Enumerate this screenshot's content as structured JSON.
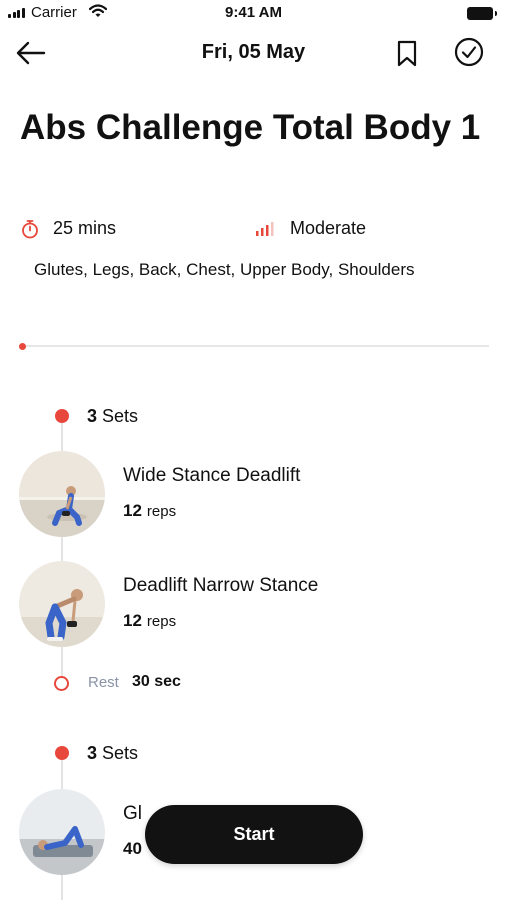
{
  "status_bar": {
    "carrier": "Carrier",
    "time": "9:41 AM",
    "icons": [
      "signal-icon",
      "wifi-icon",
      "battery-icon"
    ]
  },
  "nav": {
    "title": "Fri, 05 May",
    "icons": [
      "back-arrow-icon",
      "bookmark-icon",
      "check-circle-icon"
    ]
  },
  "workout": {
    "title": "Abs Challenge Total Body 1",
    "duration": "25 mins",
    "difficulty": "Moderate",
    "muscles": "Glutes, Legs, Back, Chest, Upper Body, Shoulders",
    "progress": 0
  },
  "colors": {
    "accent": "#e8473b",
    "text": "#111111",
    "muted": "#8a93a6",
    "button": "#121212"
  },
  "blocks": [
    {
      "sets_count": "3",
      "sets_word": "Sets",
      "exercises": [
        {
          "name": "Wide Stance Deadlift",
          "reps": "12",
          "unit": "reps"
        },
        {
          "name": "Deadlift Narrow Stance",
          "reps": "12",
          "unit": "reps"
        }
      ],
      "rest": {
        "label": "Rest",
        "value": "30 sec"
      }
    },
    {
      "sets_count": "3",
      "sets_word": "Sets",
      "exercises": [
        {
          "name": "Gl",
          "reps": "40",
          "unit": ""
        }
      ]
    }
  ],
  "start_button": {
    "label": "Start"
  }
}
